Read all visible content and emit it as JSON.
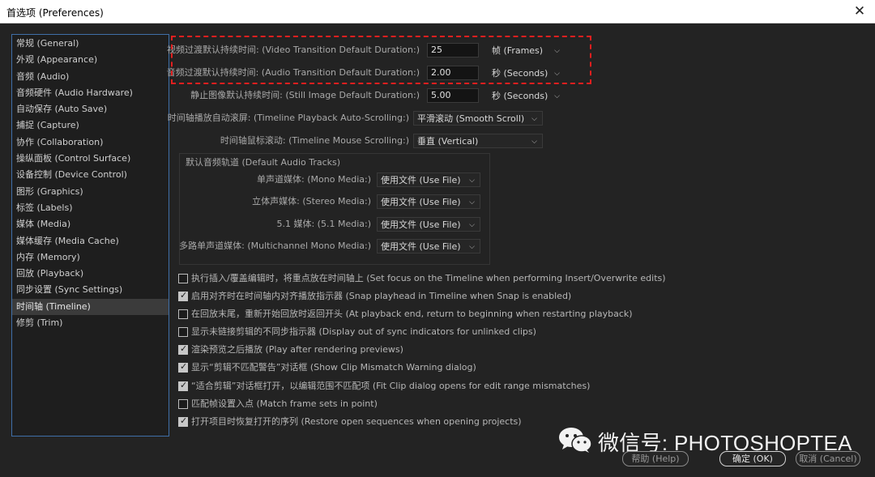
{
  "window": {
    "title": "首选项 (Preferences)",
    "close_glyph": "✕"
  },
  "sidebar": {
    "items": [
      "常规 (General)",
      "外观 (Appearance)",
      "音频 (Audio)",
      "音频硬件 (Audio Hardware)",
      "自动保存 (Auto Save)",
      "捕捉 (Capture)",
      "协作 (Collaboration)",
      "操纵面板 (Control Surface)",
      "设备控制 (Device Control)",
      "图形 (Graphics)",
      "标签 (Labels)",
      "媒体 (Media)",
      "媒体缓存 (Media Cache)",
      "内存 (Memory)",
      "回放 (Playback)",
      "同步设置 (Sync Settings)",
      "时间轴 (Timeline)",
      "修剪 (Trim)"
    ],
    "selected": "时间轴 (Timeline)"
  },
  "durations": {
    "video": {
      "label": "视频过渡默认持续时间: (Video Transition Default Duration:)",
      "value": "25",
      "unit": "帧 (Frames)"
    },
    "audio": {
      "label": "音频过渡默认持续时间: (Audio Transition Default Duration:)",
      "value": "2.00",
      "unit": "秒 (Seconds)"
    },
    "still": {
      "label": "静止图像默认持续时间: (Still Image Default Duration:)",
      "value": "5.00",
      "unit": "秒 (Seconds)"
    }
  },
  "scrolling": {
    "playback": {
      "label": "时间轴播放自动滚屏: (Timeline Playback Auto-Scrolling:)",
      "value": "平滑滚动 (Smooth Scroll)"
    },
    "mouse": {
      "label": "时间轴鼠标滚动: (Timeline Mouse Scrolling:)",
      "value": "垂直 (Vertical)"
    }
  },
  "audio_tracks": {
    "title": "默认音频轨道 (Default Audio Tracks)",
    "mono": {
      "label": "单声道媒体: (Mono Media:)",
      "value": "使用文件 (Use File)"
    },
    "stereo": {
      "label": "立体声媒体: (Stereo Media:)",
      "value": "使用文件 (Use File)"
    },
    "surround": {
      "label": "5.1 媒体: (5.1 Media:)",
      "value": "使用文件 (Use File)"
    },
    "multichannel": {
      "label": "多路单声道媒体: (Multichannel Mono Media:)",
      "value": "使用文件 (Use File)"
    }
  },
  "options": [
    {
      "label": "执行插入/覆盖编辑时，将重点放在时间轴上 (Set focus on the Timeline when performing Insert/Overwrite edits)",
      "checked": false
    },
    {
      "label": "启用对齐时在时间轴内对齐播放指示器 (Snap playhead in Timeline when Snap is enabled)",
      "checked": true
    },
    {
      "label": "在回放末尾，重新开始回放时返回开头 (At playback end, return to beginning when restarting playback)",
      "checked": false
    },
    {
      "label": "显示未链接剪辑的不同步指示器 (Display out of sync indicators for unlinked clips)",
      "checked": false
    },
    {
      "label": "渲染预览之后播放 (Play after rendering previews)",
      "checked": true
    },
    {
      "label": "显示“剪辑不匹配警告”对话框 (Show Clip Mismatch Warning dialog)",
      "checked": true
    },
    {
      "label": "“适合剪辑”对话框打开，以编辑范围不匹配项 (Fit Clip dialog opens for edit range mismatches)",
      "checked": true
    },
    {
      "label": "匹配帧设置入点 (Match frame sets in point)",
      "checked": false
    },
    {
      "label": "打开项目时恢复打开的序列 (Restore open sequences when opening projects)",
      "checked": true
    }
  ],
  "buttons": {
    "help": "帮助 (Help)",
    "ok": "确定 (OK)",
    "cancel": "取消 (Cancel)"
  },
  "watermark": {
    "text": "微信号: PHOTOSHOPTEA"
  },
  "icons": {
    "dropdown": "⌵"
  }
}
